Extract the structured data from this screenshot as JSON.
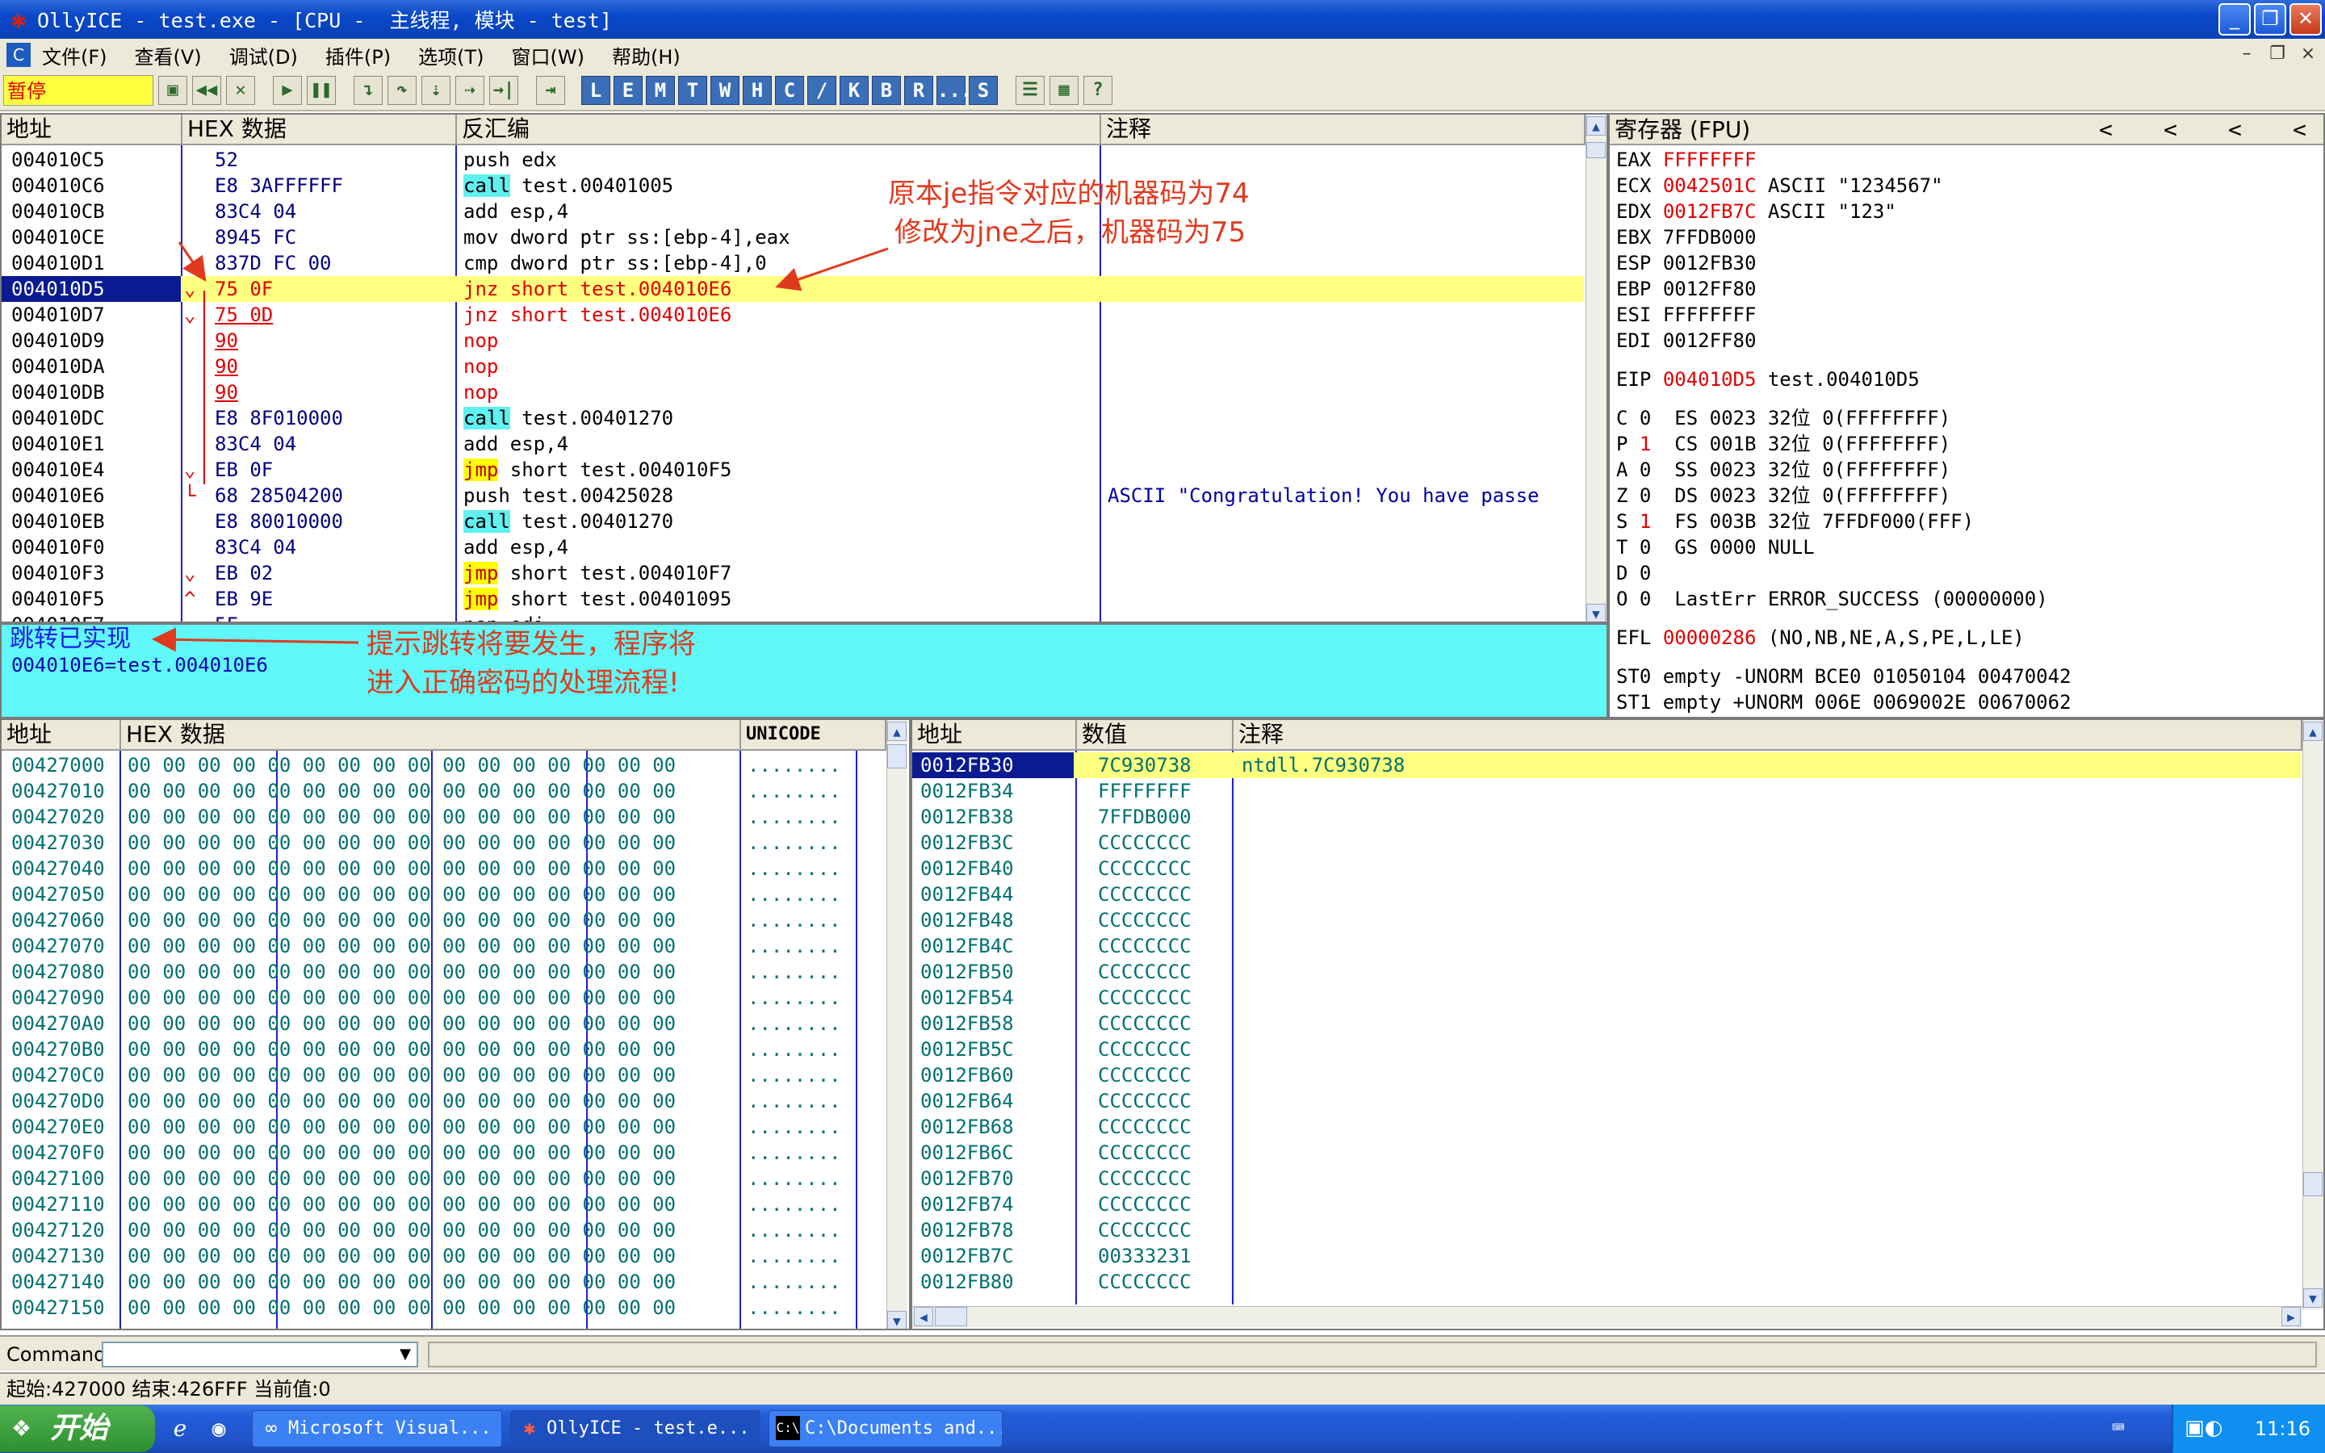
{
  "window": {
    "title": "OllyICE - test.exe - [CPU -  主线程, 模块 - test]",
    "app_icon": "bug-icon",
    "controls": [
      "minimize",
      "restore",
      "close"
    ]
  },
  "menu": {
    "items": [
      "文件(F)",
      "查看(V)",
      "调试(D)",
      "插件(P)",
      "选项(T)",
      "窗口(W)",
      "帮助(H)"
    ],
    "mdi_controls": [
      "–",
      "❐",
      "×"
    ]
  },
  "toolbar": {
    "status": "暂停",
    "letters": [
      "L",
      "E",
      "M",
      "T",
      "W",
      "H",
      "C",
      "/",
      "K",
      "B",
      "R",
      "...",
      "S"
    ]
  },
  "disasm": {
    "headers": [
      "地址",
      "HEX 数据",
      "反汇编",
      "注释"
    ],
    "rows": [
      {
        "addr": "004010C5",
        "arrow": "",
        "hex": "52",
        "mn": "",
        "op": "push edx",
        "comment": ""
      },
      {
        "addr": "004010C6",
        "arrow": "",
        "hex": "E8 3AFFFFFF",
        "mn": "call",
        "op": " test.00401005",
        "comment": ""
      },
      {
        "addr": "004010CB",
        "arrow": "",
        "hex": "83C4 04",
        "mn": "",
        "op": "add esp,4",
        "comment": ""
      },
      {
        "addr": "004010CE",
        "arrow": "",
        "hex": "8945 FC",
        "mn": "",
        "op": "mov dword ptr ss:[ebp-4],eax",
        "comment": ""
      },
      {
        "addr": "004010D1",
        "arrow": "",
        "hex": "837D FC 00",
        "mn": "",
        "op": "cmp dword ptr ss:[ebp-4],0",
        "comment": ""
      },
      {
        "addr": "004010D5",
        "arrow": "⌄",
        "hex": "75 0F",
        "mn": "",
        "op": "jnz short test.004010E6",
        "comment": "",
        "selected": true
      },
      {
        "addr": "004010D7",
        "arrow": "⌄",
        "hex": "75 0D",
        "mn": "",
        "op": "jnz short test.004010E6",
        "comment": "",
        "redop": true
      },
      {
        "addr": "004010D9",
        "arrow": "",
        "hex": "90",
        "mn": "",
        "op": "nop",
        "comment": "",
        "redop": true
      },
      {
        "addr": "004010DA",
        "arrow": "",
        "hex": "90",
        "mn": "",
        "op": "nop",
        "comment": "",
        "redop": true
      },
      {
        "addr": "004010DB",
        "arrow": "",
        "hex": "90",
        "mn": "",
        "op": "nop",
        "comment": "",
        "redop": true
      },
      {
        "addr": "004010DC",
        "arrow": "",
        "hex": "E8 8F010000",
        "mn": "call",
        "op": " test.00401270",
        "comment": ""
      },
      {
        "addr": "004010E1",
        "arrow": "",
        "hex": "83C4 04",
        "mn": "",
        "op": "add esp,4",
        "comment": ""
      },
      {
        "addr": "004010E4",
        "arrow": "⌄",
        "hex": "EB 0F",
        "mn": "jmp",
        "op": " short test.004010F5",
        "comment": ""
      },
      {
        "addr": "004010E6",
        "arrow": "└",
        "hex": "68 28504200",
        "mn": "",
        "op": "push test.00425028",
        "comment": "ASCII \"Congratulation! You have passe"
      },
      {
        "addr": "004010EB",
        "arrow": "",
        "hex": "E8 80010000",
        "mn": "call",
        "op": " test.00401270",
        "comment": ""
      },
      {
        "addr": "004010F0",
        "arrow": "",
        "hex": "83C4 04",
        "mn": "",
        "op": "add esp,4",
        "comment": ""
      },
      {
        "addr": "004010F3",
        "arrow": "⌄",
        "hex": "EB 02",
        "mn": "jmp",
        "op": " short test.004010F7",
        "comment": ""
      },
      {
        "addr": "004010F5",
        "arrow": "^",
        "hex": "EB 9E",
        "mn": "jmp",
        "op": " short test.00401095",
        "comment": ""
      },
      {
        "addr": "004010F7",
        "arrow": "",
        "hex": "5F",
        "mn": "",
        "op": "pop edi",
        "comment": ""
      }
    ]
  },
  "registers": {
    "header": "寄存器 (FPU)",
    "nav": [
      "<",
      "<",
      "<",
      "<"
    ],
    "gpr": [
      {
        "name": "EAX",
        "value": "FFFFFFFF",
        "changed": true,
        "extra": ""
      },
      {
        "name": "ECX",
        "value": "0042501C",
        "changed": true,
        "extra": " ASCII \"1234567\""
      },
      {
        "name": "EDX",
        "value": "0012FB7C",
        "changed": true,
        "extra": " ASCII \"123\""
      },
      {
        "name": "EBX",
        "value": "7FFDB000",
        "changed": false,
        "extra": ""
      },
      {
        "name": "ESP",
        "value": "0012FB30",
        "changed": false,
        "extra": ""
      },
      {
        "name": "EBP",
        "value": "0012FF80",
        "changed": false,
        "extra": ""
      },
      {
        "name": "ESI",
        "value": "FFFFFFFF",
        "changed": false,
        "extra": ""
      },
      {
        "name": "EDI",
        "value": "0012FF80",
        "changed": false,
        "extra": ""
      }
    ],
    "eip": {
      "name": "EIP",
      "value": "004010D5",
      "extra": " test.004010D5"
    },
    "flags": [
      {
        "flag": "C",
        "val": "0",
        "changed": false,
        "seg": "ES 0023 32位 0(FFFFFFFF)"
      },
      {
        "flag": "P",
        "val": "1",
        "changed": true,
        "seg": "CS 001B 32位 0(FFFFFFFF)"
      },
      {
        "flag": "A",
        "val": "0",
        "changed": false,
        "seg": "SS 0023 32位 0(FFFFFFFF)"
      },
      {
        "flag": "Z",
        "val": "0",
        "changed": false,
        "seg": "DS 0023 32位 0(FFFFFFFF)"
      },
      {
        "flag": "S",
        "val": "1",
        "changed": true,
        "seg": "FS 003B 32位 7FFDF000(FFF)"
      },
      {
        "flag": "T",
        "val": "0",
        "changed": false,
        "seg": "GS 0000 NULL"
      },
      {
        "flag": "D",
        "val": "0",
        "changed": false,
        "seg": ""
      },
      {
        "flag": "O",
        "val": "0",
        "changed": false,
        "seg": "LastErr ERROR_SUCCESS (00000000)"
      }
    ],
    "efl": {
      "name": "EFL",
      "value": "00000286",
      "extra": " (NO,NB,NE,A,S,PE,L,LE)"
    },
    "st": [
      "ST0 empty -UNORM BCE0 01050104 00470042",
      "ST1 empty +UNORM 006E 0069002E 00670062"
    ]
  },
  "info": {
    "line1": "跳转已实现",
    "line2": "004010E6=test.004010E6"
  },
  "annotations": {
    "opcode_note_1": "原本je指令对应的机器码为74",
    "opcode_note_2": "修改为jne之后，机器码为75",
    "jump_note_1": "提示跳转将要发生，程序将",
    "jump_note_2": "进入正确密码的处理流程!",
    "color": "#e03a1e"
  },
  "dump": {
    "headers": [
      "地址",
      "HEX 数据",
      "UNICODE"
    ],
    "bytes": "00 00 00 00 00 00 00 00 00 00 00 00 00 00 00 00",
    "ascii": "........",
    "addresses": [
      "00427000",
      "00427010",
      "00427020",
      "00427030",
      "00427040",
      "00427050",
      "00427060",
      "00427070",
      "00427080",
      "00427090",
      "004270A0",
      "004270B0",
      "004270C0",
      "004270D0",
      "004270E0",
      "004270F0",
      "00427100",
      "00427110",
      "00427120",
      "00427130",
      "00427140",
      "00427150"
    ]
  },
  "stack": {
    "headers": [
      "地址",
      "数值",
      "注释"
    ],
    "rows": [
      {
        "addr": "0012FB30",
        "val": "7C930738",
        "comment": "ntdll.7C930738",
        "selected": true
      },
      {
        "addr": "0012FB34",
        "val": "FFFFFFFF",
        "comment": ""
      },
      {
        "addr": "0012FB38",
        "val": "7FFDB000",
        "comment": ""
      },
      {
        "addr": "0012FB3C",
        "val": "CCCCCCCC",
        "comment": ""
      },
      {
        "addr": "0012FB40",
        "val": "CCCCCCCC",
        "comment": ""
      },
      {
        "addr": "0012FB44",
        "val": "CCCCCCCC",
        "comment": ""
      },
      {
        "addr": "0012FB48",
        "val": "CCCCCCCC",
        "comment": ""
      },
      {
        "addr": "0012FB4C",
        "val": "CCCCCCCC",
        "comment": ""
      },
      {
        "addr": "0012FB50",
        "val": "CCCCCCCC",
        "comment": ""
      },
      {
        "addr": "0012FB54",
        "val": "CCCCCCCC",
        "comment": ""
      },
      {
        "addr": "0012FB58",
        "val": "CCCCCCCC",
        "comment": ""
      },
      {
        "addr": "0012FB5C",
        "val": "CCCCCCCC",
        "comment": ""
      },
      {
        "addr": "0012FB60",
        "val": "CCCCCCCC",
        "comment": ""
      },
      {
        "addr": "0012FB64",
        "val": "CCCCCCCC",
        "comment": ""
      },
      {
        "addr": "0012FB68",
        "val": "CCCCCCCC",
        "comment": ""
      },
      {
        "addr": "0012FB6C",
        "val": "CCCCCCCC",
        "comment": ""
      },
      {
        "addr": "0012FB70",
        "val": "CCCCCCCC",
        "comment": ""
      },
      {
        "addr": "0012FB74",
        "val": "CCCCCCCC",
        "comment": ""
      },
      {
        "addr": "0012FB78",
        "val": "CCCCCCCC",
        "comment": ""
      },
      {
        "addr": "0012FB7C",
        "val": "00333231",
        "comment": ""
      },
      {
        "addr": "0012FB80",
        "val": "CCCCCCCC",
        "comment": ""
      }
    ]
  },
  "command": {
    "label": "Command",
    "value": ""
  },
  "status": {
    "text": "起始:427000 结束:426FFF 当前值:0"
  },
  "taskbar": {
    "start": "开始",
    "tasks": [
      "Microsoft Visual...",
      "OllyICE - test.e...",
      "C:\\Documents and..."
    ],
    "clock": "11:16"
  }
}
